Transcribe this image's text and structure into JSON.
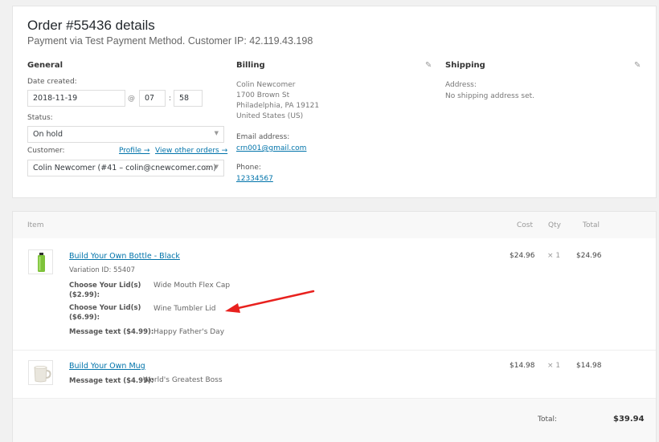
{
  "order": {
    "title": "Order #55436 details",
    "subtitle": "Payment via Test Payment Method. Customer IP: 42.119.43.198"
  },
  "general": {
    "heading": "General",
    "date_label": "Date created:",
    "date_value": "2018-11-19",
    "at_symbol": "@",
    "hour_value": "07",
    "time_sep": ":",
    "minute_value": "58",
    "status_label": "Status:",
    "status_value": "On hold",
    "customer_label": "Customer:",
    "profile_link": "Profile →",
    "other_orders_link": "View other orders →",
    "customer_value": "Colin Newcomer (#41 – colin@cnewcomer.com)",
    "clear_symbol": "×"
  },
  "billing": {
    "heading": "Billing",
    "address": [
      "Colin Newcomer",
      "1700 Brown St",
      "Philadelphia, PA 19121",
      "United States (US)"
    ],
    "email_label": "Email address:",
    "email_value": "crn001@gmail.com",
    "phone_label": "Phone:",
    "phone_value": "12334567"
  },
  "shipping": {
    "heading": "Shipping",
    "address_label": "Address:",
    "address_value": "No shipping address set."
  },
  "items_table": {
    "headers": {
      "item": "Item",
      "cost": "Cost",
      "qty": "Qty",
      "total": "Total"
    },
    "rows": [
      {
        "name": "Build Your Own Bottle - Black",
        "variation": "Variation ID: 55407",
        "meta": [
          {
            "key_line1": "Choose Your Lid(s)",
            "key_line2": "($2.99):",
            "value": "Wide Mouth Flex Cap"
          },
          {
            "key_line1": "Choose Your Lid(s)",
            "key_line2": "($6.99):",
            "value": "Wine Tumbler Lid"
          },
          {
            "key_line1": "Message text ($4.99):",
            "key_line2": "",
            "value": "Happy Father's Day"
          }
        ],
        "cost": "$24.96",
        "qty": "× 1",
        "total": "$24.96"
      },
      {
        "name": "Build Your Own Mug",
        "meta": [
          {
            "key_line1": "Message text ($4.99):",
            "key_line2": "",
            "value": "World's Greatest Boss"
          }
        ],
        "cost": "$14.98",
        "qty": "× 1",
        "total": "$14.98"
      }
    ]
  },
  "totals": {
    "label": "Total:",
    "value": "$39.94"
  },
  "colors": {
    "link": "#0073aa",
    "arrow": "#e8211e",
    "bottle_green": "#7ec23a"
  },
  "icons": [
    "pencil-icon",
    "dropdown-caret-icon",
    "bottle-icon",
    "mug-icon",
    "arrow-annotation"
  ]
}
